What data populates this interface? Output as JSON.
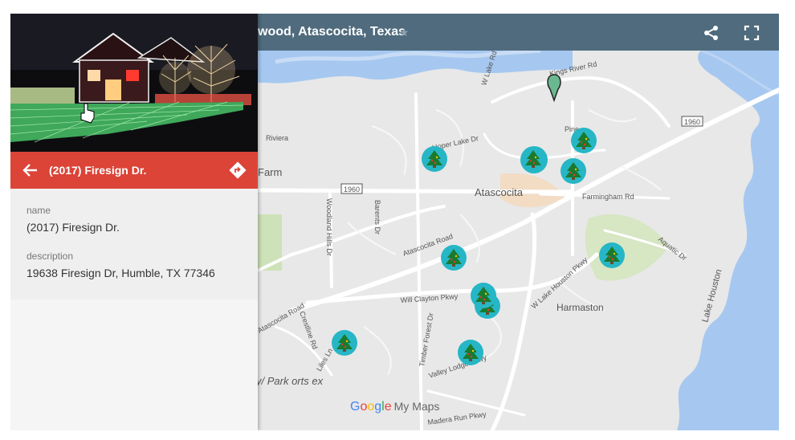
{
  "header": {
    "title": "wood, Atascocita, Texas",
    "star_icon": "star-icon",
    "share_icon": "share-icon",
    "fullscreen_icon": "fullscreen-icon"
  },
  "panel": {
    "feature_title": "(2017) Firesign Dr.",
    "fields": [
      {
        "label": "name",
        "value": "(2017) Firesign Dr."
      },
      {
        "label": "description",
        "value": "19638 Firesign Dr, Humble, TX 77346"
      }
    ],
    "back_icon": "arrow-left-icon",
    "directions_icon": "directions-icon"
  },
  "map": {
    "labels": {
      "atascocita": "Atascocita",
      "harmaston": "Harmaston",
      "farm": "Farm",
      "riviera": "Riviera",
      "hwy_1960_a": "1960",
      "hwy_1960_b": "1960",
      "kings_river": "Kings River Rd",
      "w_lake_rd": "W Lake Rd",
      "hoper_lake": "Hoper Lake Dr",
      "farmingham": "Farmingham Rd",
      "woodland_hills": "Woodland Hills Dr",
      "barents": "Barents Dr",
      "atascocita_rd": "Atascocita Road",
      "atascocita_rd2": "Atascocita Road",
      "will_clayton": "Will Clayton Pkwy",
      "w_lake_houston": "W Lake Houston Pkwy",
      "timber_forest": "Timber Forest Dr",
      "crestline": "Crestline Rd",
      "liles": "Liles Ln",
      "valley_lodge": "Valley Lodge Pkwy",
      "madera_run": "Madera Run Pkwy",
      "lake_houston": "Lake Houston",
      "aquatic": "Aquatic Dr",
      "pine": "Pine",
      "park_text": "y/ Park orts ex"
    },
    "marker_count": 12,
    "marker_color": "#26b6c6",
    "water_color": "#a6c8f0"
  },
  "branding": {
    "google": "Google",
    "my_maps": "My Maps"
  }
}
